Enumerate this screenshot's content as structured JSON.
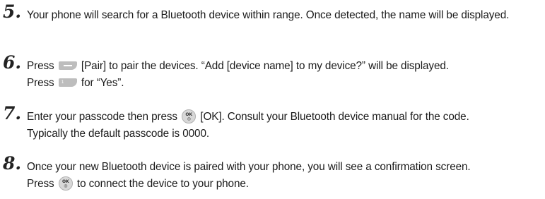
{
  "steps": [
    {
      "number": "5.",
      "text": "Your phone will search for a Bluetooth device within range.  Once detected, the name will be displayed."
    },
    {
      "number": "6.",
      "before_key1": "Press ",
      "after_key1": " [Pair] to pair the devices.  “Add [device name] to my device?” will be displayed.",
      "line2_before_key": "Press ",
      "after_key2": " for “Yes”."
    },
    {
      "number": "7.",
      "before_key": "Enter your passcode then press ",
      "after_key": " [OK].  Consult your Bluetooth device manual for the code.",
      "line2": "Typically the default passcode is 0000."
    },
    {
      "number": "8.",
      "line1": "Once your new Bluetooth device is paired with your phone, you will see a confirmation screen.",
      "before_key": "Press ",
      "after_key": " to connect the device to your phone."
    }
  ],
  "keys": {
    "ok_label": "OK",
    "one_label": "1",
    "icons": [
      "left-softkey-icon",
      "one-key-icon",
      "ok-key-icon"
    ]
  }
}
